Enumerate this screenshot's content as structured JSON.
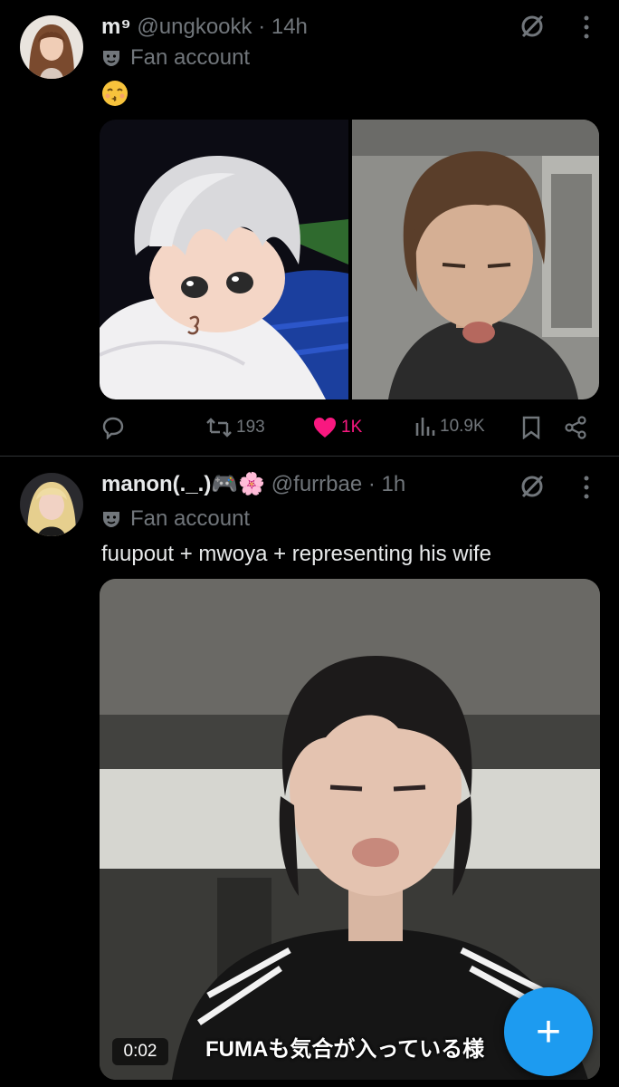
{
  "posts": [
    {
      "name": "m⁹",
      "handle": "@ungkookk",
      "time": "· 14h",
      "label": "Fan account",
      "text": "😙",
      "actions": {
        "replies": "",
        "retweets": "193",
        "likes": "1K",
        "views": "10.9K"
      }
    },
    {
      "name": "manon(._.)🎮🌸",
      "handle": "@furrbae",
      "time": "· 1h",
      "label": "Fan account",
      "text": "fuupout + mwoya + representing his wife",
      "video": {
        "duration": "0:02",
        "subtitle": "FUMAも気合が入っている様"
      }
    }
  ],
  "fab": {
    "icon": "plus-icon",
    "label": "+"
  },
  "colors": {
    "accent": "#1d9bf0",
    "like": "#f91880",
    "muted": "#71767b",
    "background": "#000000"
  }
}
